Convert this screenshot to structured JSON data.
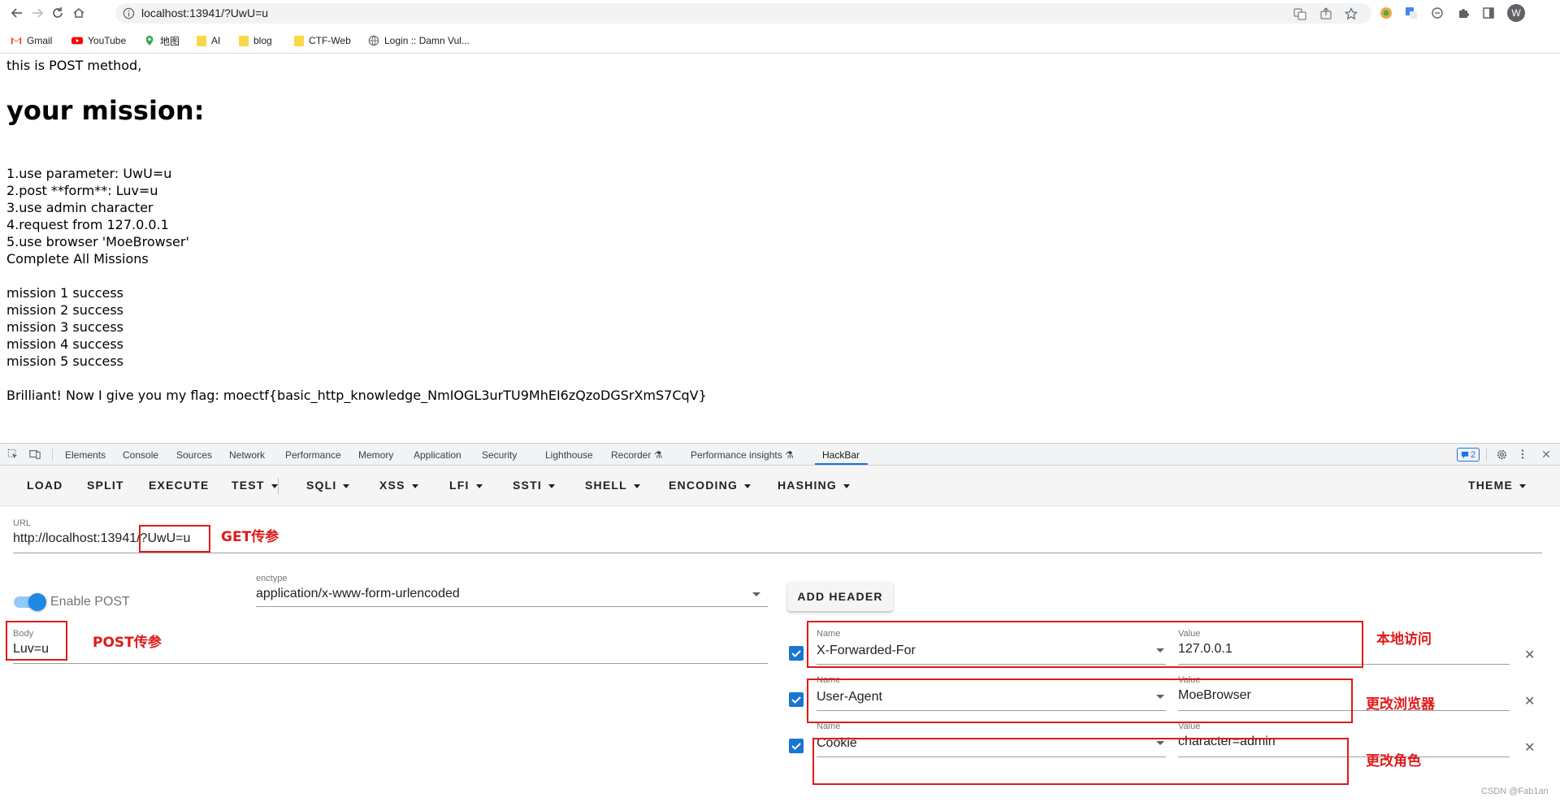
{
  "browser": {
    "url": "localhost:13941/?UwU=u",
    "avatar_letter": "W",
    "bookmarks": [
      {
        "label": "Gmail"
      },
      {
        "label": "YouTube"
      },
      {
        "label": "地图"
      },
      {
        "label": "AI"
      },
      {
        "label": "blog"
      },
      {
        "label": "CTF-Web"
      },
      {
        "label": "Login :: Damn Vul..."
      }
    ]
  },
  "page": {
    "intro": "this is POST method,",
    "heading": "your mission:",
    "missions": [
      "1.use parameter: UwU=u",
      "2.post **form**: Luv=u",
      "3.use admin character",
      "4.request from 127.0.0.1",
      "5.use browser 'MoeBrowser'",
      "Complete All Missions"
    ],
    "results": [
      "mission 1 success",
      "mission 2 success",
      "mission 3 success",
      "mission 4 success",
      "mission 5 success"
    ],
    "flag_line": "Brilliant! Now I give you my flag: moectf{basic_http_knowledge_NmIOGL3urTU9MhEI6zQzoDGSrXmS7CqV}"
  },
  "devtools": {
    "tabs": [
      "Elements",
      "Console",
      "Sources",
      "Network",
      "Performance",
      "Memory",
      "Application",
      "Security",
      "Lighthouse",
      "Recorder",
      "Performance insights",
      "HackBar"
    ],
    "issues_count": "2"
  },
  "hackbar": {
    "menu": [
      "LOAD",
      "SPLIT",
      "EXECUTE",
      "TEST",
      "SQLI",
      "XSS",
      "LFI",
      "SSTI",
      "SHELL",
      "ENCODING",
      "HASHING",
      "THEME"
    ],
    "url_label": "URL",
    "url_value": "http://localhost:13941/?UwU=u",
    "enable_post_label": "Enable POST",
    "enctype_label": "enctype",
    "enctype_value": "application/x-www-form-urlencoded",
    "add_header_label": "ADD HEADER",
    "body_label": "Body",
    "body_value": "Luv=u",
    "name_label": "Name",
    "value_label": "Value",
    "headers": [
      {
        "name": "X-Forwarded-For",
        "value": "127.0.0.1"
      },
      {
        "name": "User-Agent",
        "value": "MoeBrowser"
      },
      {
        "name": "Cookie",
        "value": "character=admin"
      }
    ]
  },
  "annotations": {
    "get": "GET传参",
    "post": "POST传参",
    "local": "本地访问",
    "browser": "更改浏览器",
    "role": "更改角色"
  },
  "watermark": "CSDN @Fab1an"
}
